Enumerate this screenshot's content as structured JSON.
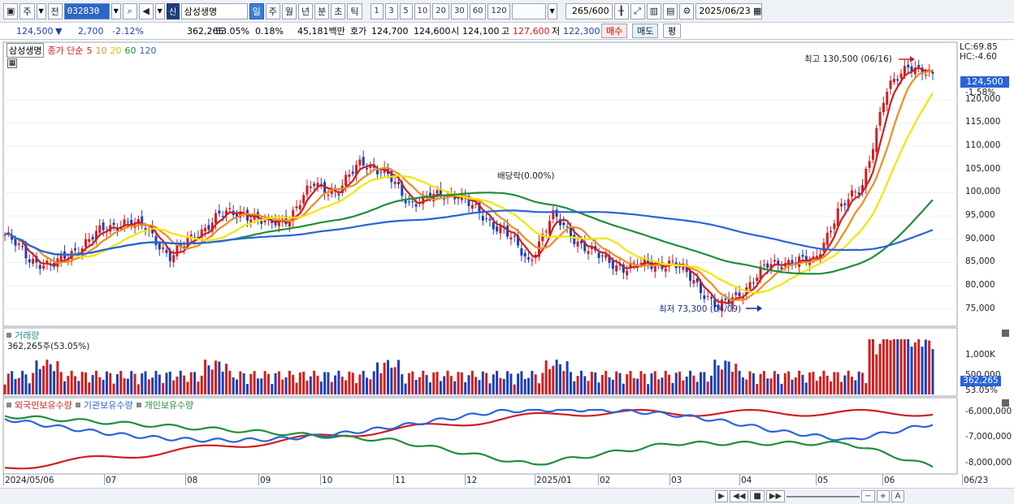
{
  "toolbar": {
    "main_btn": "주",
    "prev_btn": "전",
    "stock_code": "032830",
    "shin": "신",
    "stock_name": "삼성생명",
    "periods": [
      "일",
      "주",
      "월",
      "년",
      "분",
      "초",
      "틱"
    ],
    "active_period": "일",
    "intervals": [
      "1",
      "3",
      "5",
      "10",
      "20",
      "30",
      "60",
      "120"
    ],
    "count": "265",
    "count_max": "/600",
    "date": "2025/06/23"
  },
  "infobar": {
    "price": "124,500",
    "change": "2,700",
    "change_pct": "-2.12%",
    "volume": "362,265",
    "vol_pct": "53.05%",
    "turnover_pct": "0.18%",
    "amount": "45,181백만",
    "quote_label": "호가",
    "ask": "124,700",
    "bid": "124,600",
    "open_label": "시",
    "open": "124,100",
    "high_label": "고",
    "high": "127,600",
    "low_label": "저",
    "low": "122,300",
    "buy_btn": "매수",
    "sell_btn": "매도",
    "eval_btn": "평"
  },
  "price_panel": {
    "stock": "삼성생명",
    "ma_label": "종가 단순",
    "ma_periods": [
      "5",
      "10",
      "20",
      "60",
      "120"
    ],
    "ma_colors": [
      "#d21e1e",
      "#f28c1e",
      "#f2e600",
      "#1f8f3a",
      "#2b63d9"
    ],
    "lc": "LC:69.85",
    "hc": "HC:-4.60",
    "current_price": "124,500",
    "current_pct": "-1.58%",
    "high_note": "최고 130,500 (06/16)",
    "low_note": "최저 73,300 (04/09)",
    "dividend_note": "배당락(0.00%)",
    "y_ticks": [
      "120,000",
      "115,000",
      "110,000",
      "105,000",
      "100,000",
      "95,000",
      "90,000",
      "85,000",
      "80,000",
      "75,000"
    ]
  },
  "volume_panel": {
    "title": "거래량",
    "value": "362,265주(53.05%)",
    "y_ticks": [
      "1,000K",
      "500,000"
    ],
    "current": "362,265",
    "current_pct": "53.05%"
  },
  "holdings_panel": {
    "series": [
      "외국인보유수량",
      "기관보유수량",
      "개인보유수량"
    ],
    "colors": [
      "#d21e1e",
      "#2b63d9",
      "#1f8f3a"
    ],
    "y_ticks": [
      "-6,000,000",
      "-7,000,000",
      "-8,000,000"
    ]
  },
  "x_axis": [
    "2024/05/06",
    "07",
    "08",
    "09",
    "10",
    "11",
    "12",
    "2025/01",
    "02",
    "03",
    "04",
    "05",
    "06",
    "06/23"
  ],
  "chart_data": {
    "type": "line",
    "series": [
      {
        "name": "종가",
        "values": [
          91000,
          86000,
          84000,
          88000,
          91500,
          94000,
          92000,
          86000,
          91000,
          95000,
          96000,
          93000,
          95000,
          102000,
          100000,
          107000,
          104000,
          98000,
          99000,
          100000,
          95000,
          92000,
          85000,
          95000,
          90000,
          86000,
          84000,
          84500,
          85000,
          81000,
          75000,
          79000,
          84000,
          85500,
          85000,
          96000,
          101000,
          121000,
          128000,
          124500
        ]
      }
    ],
    "ylim": [
      72000,
      132000
    ]
  }
}
